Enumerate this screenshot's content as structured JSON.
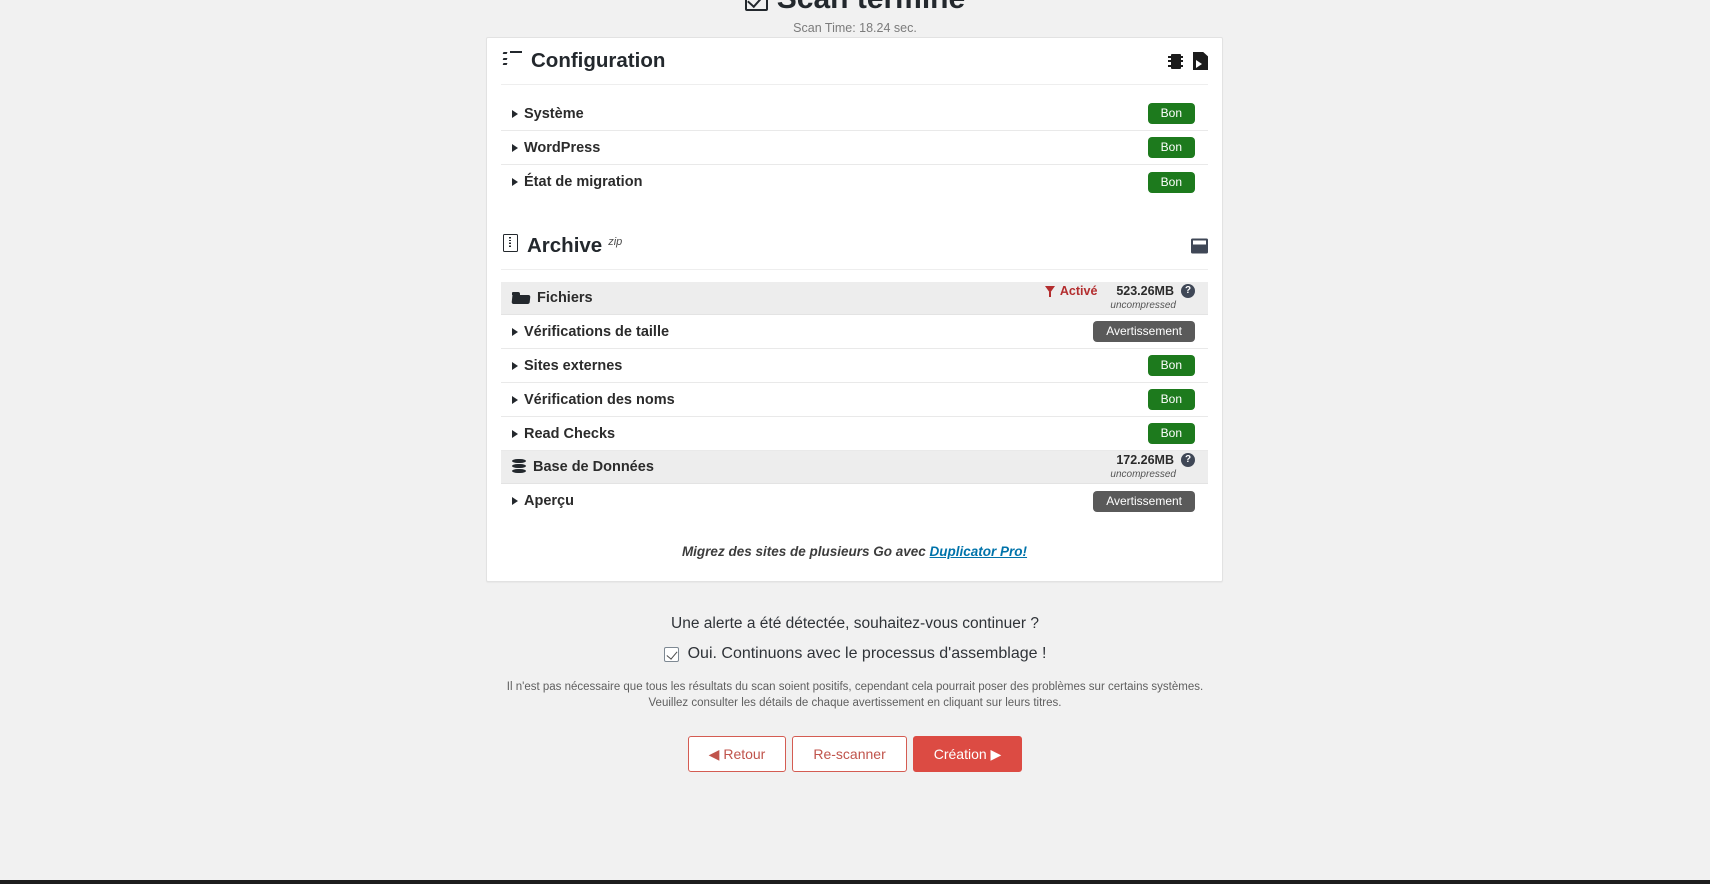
{
  "header": {
    "check_icon": "check-square-icon",
    "title": "Scan terminé",
    "scan_time": "Scan Time: 18.24 sec."
  },
  "configuration": {
    "icon": "list-check-icon",
    "title": "Configuration",
    "actions": [
      {
        "icon": "memory-chip-icon",
        "name": "memory-info-button"
      },
      {
        "icon": "file-export-icon",
        "name": "scan-log-button"
      }
    ],
    "rows": [
      {
        "label": "Système",
        "badge": "Bon",
        "status": "good"
      },
      {
        "label": "WordPress",
        "badge": "Bon",
        "status": "good"
      },
      {
        "label": "État de migration",
        "badge": "Bon",
        "status": "good"
      }
    ]
  },
  "archive": {
    "icon": "archive-file-icon",
    "title": "Archive",
    "superscript": "zip",
    "actions": [
      {
        "icon": "save-disk-icon",
        "name": "archive-save-button"
      }
    ],
    "files_section": {
      "icon": "folder-icon",
      "label": "Fichiers",
      "filter_icon": "filter-icon",
      "filter_label": "Activé",
      "size": "523.26MB",
      "help_icon": "help-circle-icon",
      "help_glyph": "?",
      "size_note": "uncompressed"
    },
    "file_rows": [
      {
        "label": "Vérifications de taille",
        "badge": "Avertissement",
        "status": "warn"
      },
      {
        "label": "Sites externes",
        "badge": "Bon",
        "status": "good"
      },
      {
        "label": "Vérification des noms",
        "badge": "Bon",
        "status": "good"
      },
      {
        "label": "Read Checks",
        "badge": "Bon",
        "status": "good"
      }
    ],
    "database_section": {
      "icon": "database-icon",
      "label": "Base de Données",
      "size": "172.26MB",
      "help_icon": "help-circle-icon",
      "help_glyph": "?",
      "size_note": "uncompressed"
    },
    "database_rows": [
      {
        "label": "Aperçu",
        "badge": "Avertissement",
        "status": "warn"
      }
    ]
  },
  "promo": {
    "text": "Migrez des sites de plusieurs Go avec ",
    "link": "Duplicator Pro!"
  },
  "footer": {
    "alert_question": "Une alerte a été détectée, souhaitez-vous continuer ?",
    "confirm_label": "Oui. Continuons avec le processus d'assemblage !",
    "note_line1": "Il n'est pas nécessaire que tous les résultats du scan soient positifs, cependant cela pourrait poser des problèmes sur certains systèmes.",
    "note_line2": "Veuillez consulter les détails de chaque avertissement en cliquant sur leurs titres.",
    "buttons": {
      "back": "◀ Retour",
      "rescan": "Re-scanner",
      "build": "Création ▶"
    }
  },
  "colors": {
    "good": "#1d7a1d",
    "warn": "#5a5a5a",
    "accent_red": "#dc4b43",
    "link_blue": "#0073aa",
    "filter_red": "#b32d2e"
  }
}
